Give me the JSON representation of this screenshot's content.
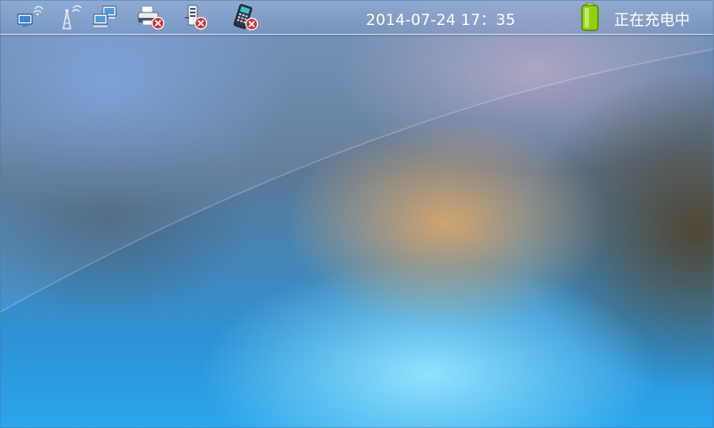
{
  "status_bar": {
    "datetime": "2014-07-24 17：35",
    "charging_status": "正在充电中",
    "icons": [
      {
        "name": "wireless-computer-icon",
        "error": false
      },
      {
        "name": "signal-tower-icon",
        "error": false
      },
      {
        "name": "network-computers-icon",
        "error": false
      },
      {
        "name": "printer-icon",
        "error": true
      },
      {
        "name": "card-reader-icon",
        "error": true
      },
      {
        "name": "pos-terminal-icon",
        "error": true
      }
    ]
  },
  "colors": {
    "error_badge": "#d32f2f",
    "battery_fill": "#8fd400"
  }
}
